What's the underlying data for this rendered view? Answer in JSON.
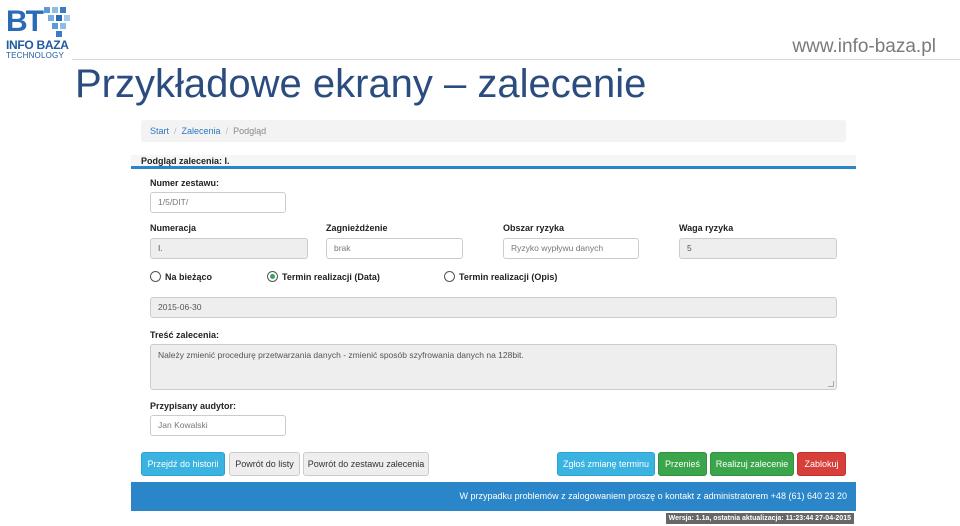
{
  "slide": {
    "logo_bt": "BT",
    "logo_info": "INFO BAZA",
    "logo_tech": "TECHNOLOGY",
    "url": "www.info-baza.pl",
    "title": "Przykładowe ekrany – zalecenie"
  },
  "breadcrumb": {
    "start": "Start",
    "zalecenia": "Zalecenia",
    "current": "Podgląd",
    "separator": "/"
  },
  "panel": {
    "title": "Podgląd zalecenia: I."
  },
  "form": {
    "numer_zestawu_label": "Numer zestawu:",
    "numer_zestawu_value": "1/5/DIT/",
    "numeracja_label": "Numeracja",
    "numeracja_value": "I.",
    "zagniezdzenie_label": "Zagnieżdżenie",
    "zagniezdzenie_value": "brak",
    "obszar_label": "Obszar ryzyka",
    "obszar_value": "Ryzyko wypływu danych",
    "waga_label": "Waga ryzyka",
    "waga_value": "5",
    "radio_na_biezaco": "Na bieżąco",
    "radio_termin_data": "Termin realizacji (Data)",
    "radio_termin_opis": "Termin realizacji (Opis)",
    "selected_radio": "termin_data",
    "termin_value": "2015-06-30",
    "tresc_label": "Treść zalecenia:",
    "tresc_value": "Należy zmienić procedurę przetwarzania danych - zmienić sposób szyfrowania danych na 128bit.",
    "audytor_label": "Przypisany audytor:",
    "audytor_value": "Jan Kowalski"
  },
  "buttons": {
    "historia": "Przejdź do historii",
    "powrot_lista": "Powrót do listy",
    "powrot_zestaw": "Powrót do zestawu zalecenia",
    "zglos": "Zgłoś zmianę terminu",
    "przenies": "Przenieś",
    "realizuj": "Realizuj zalecenie",
    "zablokuj": "Zablokuj"
  },
  "footer": {
    "contact": "W przypadku problemów z zalogowaniem proszę o kontakt z administratorem +48 (61) 640 23 20",
    "version": "Wersja: 1.1a, ostatnia aktualizacja: 11:23:44 27-04-2015"
  },
  "colors": {
    "primary": "#2a86c8",
    "info": "#3bb3e0",
    "success": "#3aa54b",
    "danger": "#d63f3a",
    "title": "#2b4c7e"
  }
}
